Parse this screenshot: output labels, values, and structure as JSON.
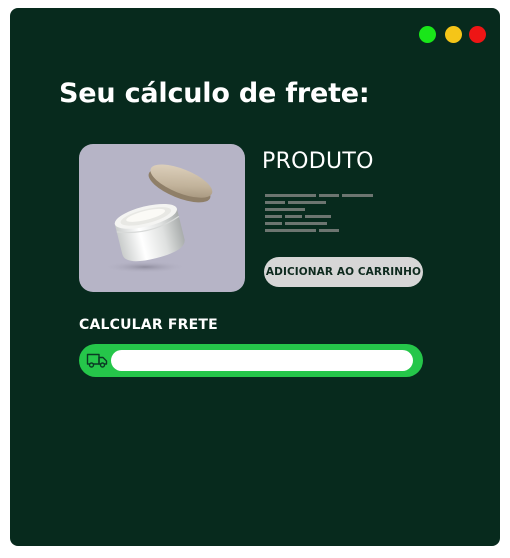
{
  "window": {
    "controls": [
      {
        "name": "maximize",
        "color": "#19e619"
      },
      {
        "name": "minimize",
        "color": "#f5c518"
      },
      {
        "name": "close",
        "color": "#ee1515"
      }
    ]
  },
  "page": {
    "title": "Seu cálculo de frete:"
  },
  "product": {
    "name": "PRODUTO",
    "image_icon": "cosmetic-jar-image",
    "description_lines": 6,
    "add_to_cart_label": "ADICIONAR AO CARRINHO"
  },
  "shipping": {
    "label": "CALCULAR FRETE",
    "icon": "truck-icon",
    "input_value": "",
    "input_placeholder": ""
  },
  "colors": {
    "background": "#072a1d",
    "accent_green": "#25c64a",
    "button_bg": "#d6d6d6",
    "image_bg": "#b6b4c6"
  }
}
